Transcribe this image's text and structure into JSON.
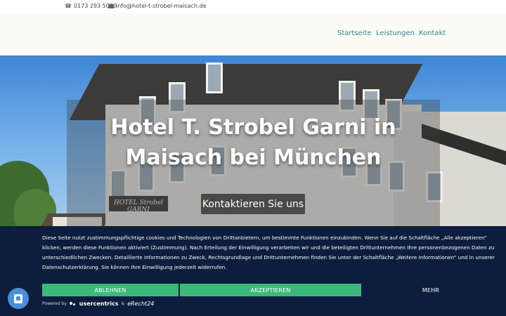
{
  "topbar": {
    "phone": "0173 293 5000",
    "email": "info@hotel-t-strobel-maisach.de",
    "phone_icon": "phone-icon",
    "email_icon": "envelope-icon"
  },
  "nav": {
    "items": [
      {
        "label": "Startseite"
      },
      {
        "label": "Leistungen"
      },
      {
        "label": "Kontakt"
      }
    ]
  },
  "hero": {
    "title": "Hotel T. Strobel Garni in Maisach bei München",
    "cta_label": "Kontaktieren Sie uns",
    "sign_text": "HOTEL Strobel GARNI"
  },
  "cookie": {
    "text": "Diese Seite nutzt zustimmungspflichtige cookies und Technologien von Drittanbietern, um bestimmte Funktionen einzubinden. Wenn Sie auf die Schaltfläche „Alle akzeptieren“ klicken, werden diese Funktionen aktiviert (Zustimmung). Nach Erteilung der Einwilligung verarbeiten wir und die beteiligten Drittunternehmen Ihre personenbezogenen Daten zu unterschiedlichen Zwecken. Detaillierte Informationen zu Zweck, Rechtsgrundlage und Drittunternehmen finden Sie unter der Schaltfläche „Weitere Informationen“ und in unserer Datenschutzerklärung. Sie können Ihre Einwilligung jederzeit widerrufen.",
    "reject_label": "ABLEHNEN",
    "accept_label": "AKZEPTIEREN",
    "more_label": "MEHR",
    "powered_by": "Powered by",
    "brand_usercentrics": "usercentrics",
    "ampersand": "&",
    "brand_erecht": "eRecht24",
    "button_color": "#3cb87d",
    "background_color": "#0d1d3d"
  },
  "colors": {
    "nav_accent": "#2a8b8b",
    "header_bg": "#fdfbf6"
  }
}
